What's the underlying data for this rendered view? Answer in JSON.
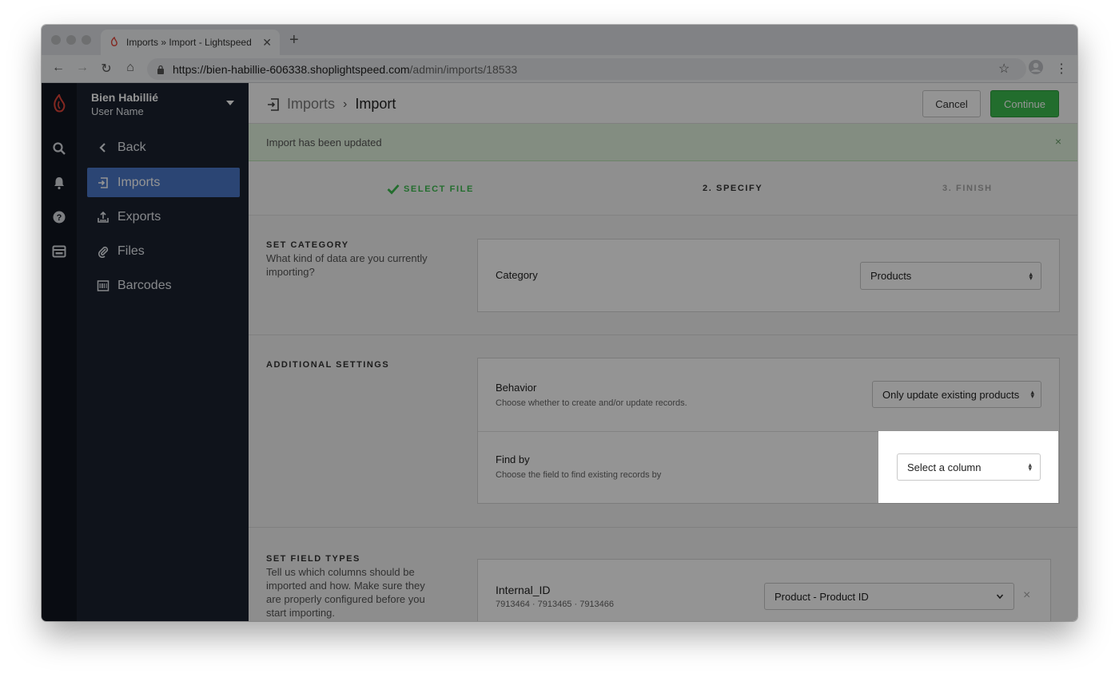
{
  "browser": {
    "tab_title": "Imports » Import - Lightspeed",
    "new_tab": "+",
    "url_host": "https://bien-habillie-606338.shoplightspeed.com",
    "url_path": "/admin/imports/18533"
  },
  "account": {
    "store_name": "Bien Habillié",
    "user_name": "User Name"
  },
  "rail_icons": [
    "logo-icon",
    "search-icon",
    "bell-icon",
    "help-icon",
    "store-icon"
  ],
  "sidebar": {
    "back_label": "Back",
    "items": [
      {
        "label": "Imports",
        "icon": "import-icon",
        "active": true
      },
      {
        "label": "Exports",
        "icon": "export-icon",
        "active": false
      },
      {
        "label": "Files",
        "icon": "paperclip-icon",
        "active": false
      },
      {
        "label": "Barcodes",
        "icon": "barcode-icon",
        "active": false
      }
    ]
  },
  "header": {
    "crumb_parent": "Imports",
    "crumb_current": "Import",
    "cancel_label": "Cancel",
    "continue_label": "Continue"
  },
  "banner": {
    "message": "Import has been updated",
    "close": "×"
  },
  "steps": {
    "step1": "SELECT FILE",
    "step2": "2. SPECIFY",
    "step3": "3. FINISH"
  },
  "category_section": {
    "title": "SET CATEGORY",
    "description": "What kind of data are you currently importing?",
    "field_label": "Category",
    "selected": "Products"
  },
  "additional_section": {
    "title": "ADDITIONAL SETTINGS",
    "behavior_label": "Behavior",
    "behavior_sub": "Choose whether to create and/or update records.",
    "behavior_selected": "Only update existing products",
    "findby_label": "Find by",
    "findby_sub": "Choose the field to find existing records by",
    "findby_selected": "Select a column"
  },
  "field_types_section": {
    "title": "SET FIELD TYPES",
    "description": "Tell us which columns should be imported and how. Make sure they are properly configured before you start importing.",
    "field_name": "Internal_ID",
    "field_samples": "7913464 · 7913465 · 7913466",
    "field_selected": "Product - Product ID",
    "remove": "×"
  },
  "colors": {
    "accent_green": "#3cbc4e",
    "sidebar_bg": "#1a2230",
    "active_nav": "#4a78c8",
    "brand_red": "#e2453a"
  }
}
